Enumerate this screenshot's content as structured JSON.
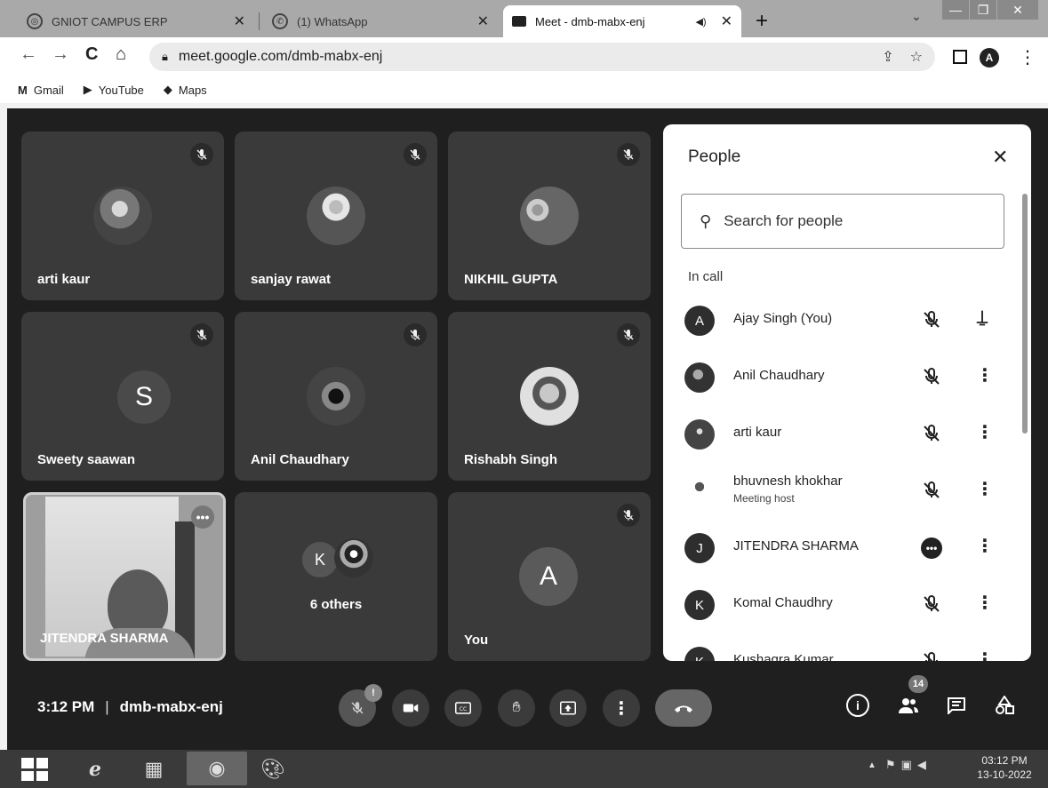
{
  "browser": {
    "tabs": [
      {
        "title": "GNIOT CAMPUS ERP",
        "icon": "globe-icon",
        "active": false
      },
      {
        "title": "(1) WhatsApp",
        "icon": "whatsapp-icon",
        "active": false
      },
      {
        "title": "Meet - dmb-mabx-enj",
        "icon": "meet-icon",
        "active": true
      }
    ],
    "tab_close_glyph": "✕",
    "url": "meet.google.com/dmb-mabx-enj",
    "profile_initial": "A",
    "bookmarks": [
      {
        "label": "Gmail",
        "icon": "M"
      },
      {
        "label": "YouTube",
        "icon": "▶"
      },
      {
        "label": "Maps",
        "icon": "◆"
      }
    ]
  },
  "meet": {
    "tiles": [
      {
        "name": "arti kaur",
        "kind": "photo",
        "muted": true
      },
      {
        "name": "sanjay rawat",
        "kind": "photo",
        "muted": true
      },
      {
        "name": "NIKHIL GUPTA",
        "kind": "photo",
        "muted": true
      },
      {
        "name": "Sweety saawan",
        "kind": "letter",
        "letter": "S",
        "muted": true
      },
      {
        "name": "Anil Chaudhary",
        "kind": "photo",
        "muted": true
      },
      {
        "name": "Rishabh Singh",
        "kind": "photo",
        "muted": true
      },
      {
        "name": "JITENDRA SHARMA",
        "kind": "camera",
        "muted": false
      },
      {
        "name": "6 others",
        "kind": "group",
        "letter": "K"
      },
      {
        "name": "You",
        "kind": "letter",
        "letter": "A",
        "muted": true
      }
    ],
    "people_panel": {
      "title": "People",
      "search_placeholder": "Search for people",
      "section_label": "In call",
      "participants": [
        {
          "name": "Ajay Singh (You)",
          "avatar": "A",
          "status": "muted",
          "action": "pin"
        },
        {
          "name": "Anil Chaudhary",
          "avatar": "photo",
          "status": "muted",
          "action": "more"
        },
        {
          "name": "arti kaur",
          "avatar": "photo",
          "status": "muted",
          "action": "more"
        },
        {
          "name": "bhuvnesh khokhar",
          "sub": "Meeting host",
          "avatar": "photo",
          "status": "muted",
          "action": "more"
        },
        {
          "name": "JITENDRA SHARMA",
          "avatar": "J",
          "status": "speaking",
          "action": "more"
        },
        {
          "name": "Komal Chaudhry",
          "avatar": "K",
          "status": "muted",
          "action": "more"
        },
        {
          "name": "Kushagra Kumar",
          "avatar": "K",
          "status": "muted",
          "action": "more"
        }
      ]
    },
    "controls": {
      "time": "3:12 PM",
      "separator": "|",
      "meeting_code": "dmb-mabx-enj",
      "mic_alert": "!",
      "people_count": "14"
    }
  },
  "taskbar": {
    "clock_time": "03:12 PM",
    "clock_date": "13-10-2022"
  }
}
